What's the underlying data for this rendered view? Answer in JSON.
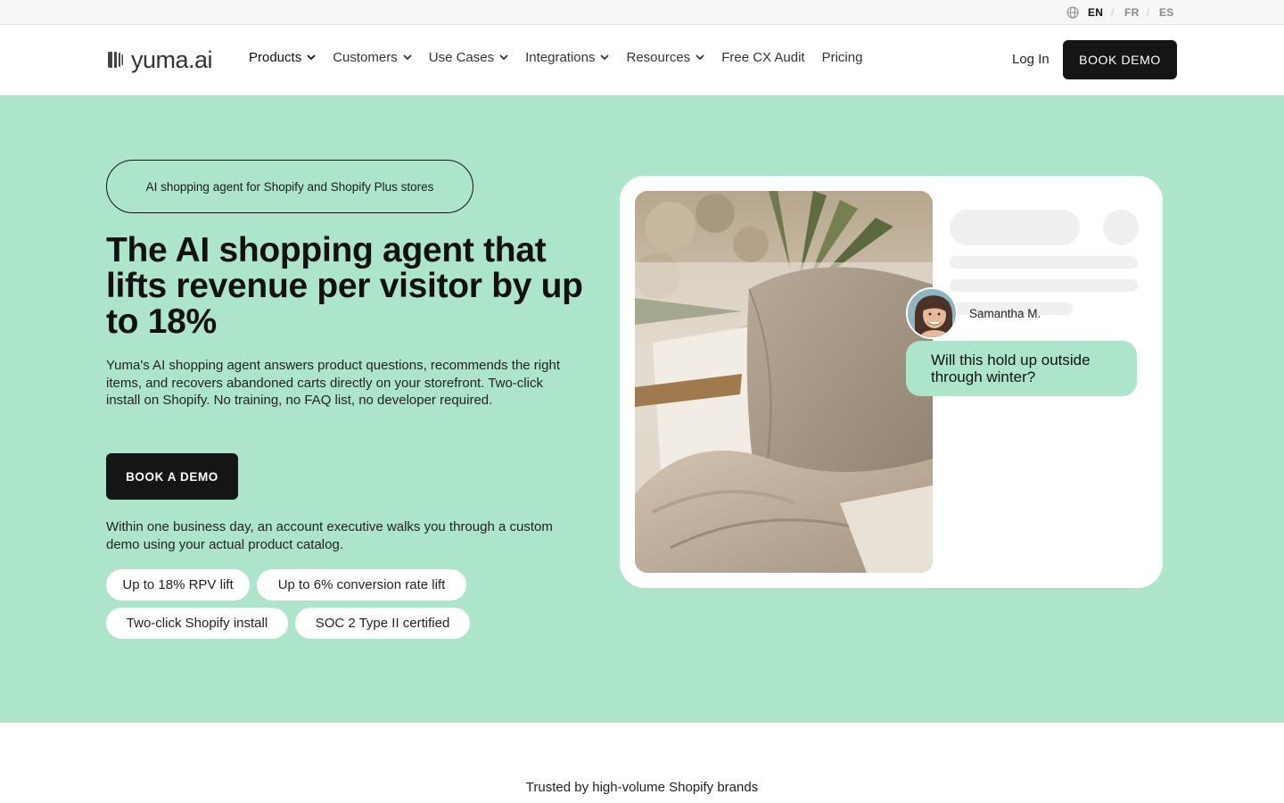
{
  "langbar": {
    "languages": [
      "EN",
      "FR",
      "ES"
    ],
    "active": "EN",
    "icon": "globe-icon"
  },
  "header": {
    "logo_text": "yuma.ai",
    "nav": [
      {
        "label": "Products",
        "dropdown": true
      },
      {
        "label": "Customers",
        "dropdown": true
      },
      {
        "label": "Use Cases",
        "dropdown": true
      },
      {
        "label": "Integrations",
        "dropdown": true
      },
      {
        "label": "Resources",
        "dropdown": true
      },
      {
        "label": "Free CX Audit",
        "dropdown": false
      },
      {
        "label": "Pricing",
        "dropdown": false
      }
    ],
    "login_label": "Log In",
    "cta_label": "BOOK DEMO"
  },
  "hero": {
    "tag": "AI shopping agent for Shopify and Shopify Plus stores",
    "title": "The AI shopping agent that lifts revenue per visitor by up to 18%",
    "description": "Yuma's AI shopping agent answers product questions, recommends the right items, and recovers abandoned carts directly on your storefront. Two-click install on Shopify. No training, no FAQ list, no developer required.",
    "cta_label": "BOOK A DEMO",
    "note": "Within one business day, an account executive walks you through a custom demo using your actual product catalog.",
    "chips": [
      "Up to 18% RPV lift",
      "Up to 6% conversion rate lift",
      "Two-click Shopify install",
      "SOC 2 Type II certified"
    ],
    "chat": {
      "sender": "Samantha M.",
      "message": "Will this hold up outside through winter?"
    }
  },
  "trusted": {
    "text": "Trusted by high-volume Shopify brands"
  },
  "colors": {
    "hero_bg": "#ade5ca",
    "dark": "#151515",
    "bubble": "#ade5ca"
  }
}
